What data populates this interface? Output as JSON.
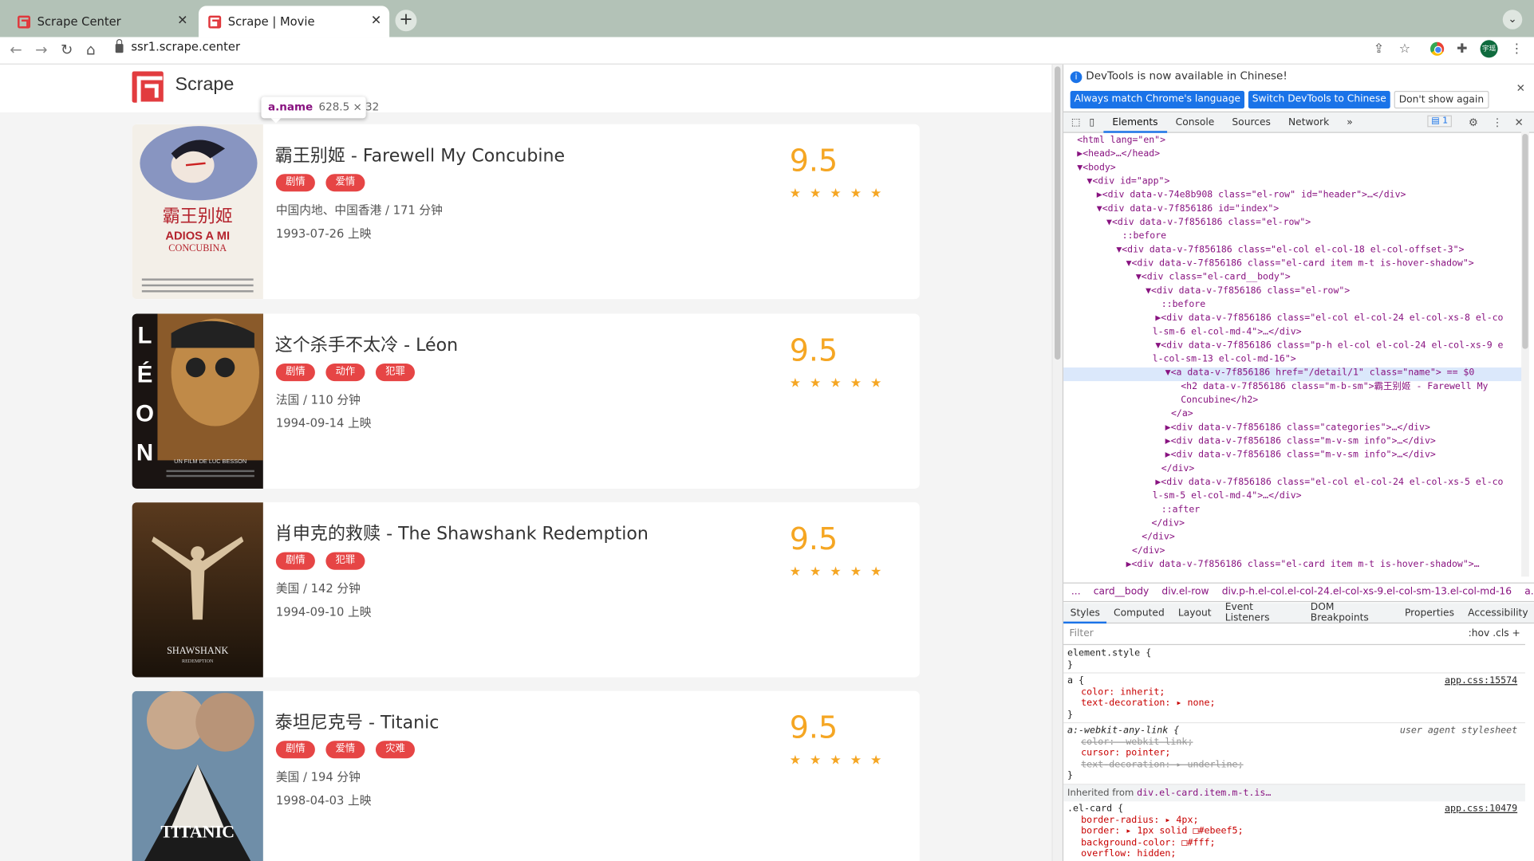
{
  "browser": {
    "tabs": [
      {
        "title": "Scrape Center",
        "active": false
      },
      {
        "title": "Scrape | Movie",
        "active": true
      }
    ],
    "url": "ssr1.scrape.center",
    "profile_initials": "宇瑶"
  },
  "site": {
    "brand": "Scrape",
    "inspect_tooltip": {
      "selector": "a.name",
      "size": "628.5 × 32"
    },
    "movies": [
      {
        "title": "霸王别姬 - Farewell My Concubine",
        "categories": [
          "剧情",
          "爱情"
        ],
        "region_duration": "中国内地、中国香港 / 171 分钟",
        "release": "1993-07-26 上映",
        "score": "9.5",
        "poster": "farewell-my-concubine-poster"
      },
      {
        "title": "这个杀手不太冷 - Léon",
        "categories": [
          "剧情",
          "动作",
          "犯罪"
        ],
        "region_duration": "法国 / 110 分钟",
        "release": "1994-09-14 上映",
        "score": "9.5",
        "poster": "leon-poster"
      },
      {
        "title": "肖申克的救赎 - The Shawshank Redemption",
        "categories": [
          "剧情",
          "犯罪"
        ],
        "region_duration": "美国 / 142 分钟",
        "release": "1994-09-10 上映",
        "score": "9.5",
        "poster": "shawshank-poster"
      },
      {
        "title": "泰坦尼克号 - Titanic",
        "categories": [
          "剧情",
          "爱情",
          "灾难"
        ],
        "region_duration": "美国 / 194 分钟",
        "release": "1998-04-03 上映",
        "score": "9.5",
        "poster": "titanic-poster"
      }
    ],
    "star_rating": {
      "value": 5,
      "max": 5
    }
  },
  "devtools": {
    "notice": "DevTools is now available in Chinese!",
    "notice_buttons": [
      "Always match Chrome's language",
      "Switch DevTools to Chinese",
      "Don't show again"
    ],
    "tabs": [
      "Elements",
      "Console",
      "Sources",
      "Network"
    ],
    "issues_count": "1",
    "breadcrumbs": [
      "...",
      "card__body",
      "div.el-row",
      "div.p-h.el-col.el-col-24.el-col-xs-9.el-col-sm-13.el-col-md-16",
      "a.name"
    ],
    "style_tabs": [
      "Styles",
      "Computed",
      "Layout",
      "Event Listeners",
      "DOM Breakpoints",
      "Properties",
      "Accessibility"
    ],
    "filter_placeholder": "Filter",
    "filter_tools": ":hov  .cls  +",
    "dom_lines": [
      "<html lang=\"en\">",
      "▶<head>…</head>",
      "▼<body>",
      "▼<div id=\"app\">",
      "▶<div data-v-74e8b908 class=\"el-row\" id=\"header\">…</div>",
      "▼<div data-v-7f856186 id=\"index\">",
      "▼<div data-v-7f856186 class=\"el-row\">",
      "::before",
      "▼<div data-v-7f856186 class=\"el-col el-col-18 el-col-offset-3\">",
      "▼<div data-v-7f856186 class=\"el-card item m-t is-hover-shadow\">",
      "▼<div class=\"el-card__body\">",
      "▼<div data-v-7f856186 class=\"el-row\">",
      "::before",
      "▶<div data-v-7f856186 class=\"el-col el-col-24 el-col-xs-8 el-co",
      "l-sm-6 el-col-md-4\">…</div>",
      "▼<div data-v-7f856186 class=\"p-h el-col el-col-24 el-col-xs-9 e",
      "l-col-sm-13 el-col-md-16\">",
      "▼<a data-v-7f856186 href=\"/detail/1\" class=\"name\"> == $0",
      "<h2 data-v-7f856186 class=\"m-b-sm\">霸王别姬 - Farewell My",
      "Concubine</h2>",
      "</a>",
      "▶<div data-v-7f856186 class=\"categories\">…</div>",
      "▶<div data-v-7f856186 class=\"m-v-sm info\">…</div>",
      "▶<div data-v-7f856186 class=\"m-v-sm info\">…</div>",
      "</div>",
      "▶<div data-v-7f856186 class=\"el-col el-col-24 el-col-xs-5 el-co",
      "l-sm-5 el-col-md-4\">…</div>",
      "::after",
      "</div>",
      "</div>",
      "</div>",
      "▶<div data-v-7f856186 class=\"el-card item m-t is-hover-shadow\">…"
    ],
    "styles": {
      "element_style": "element.style {",
      "a_rule": {
        "selector": "a {",
        "source": "app.css:15574",
        "props": [
          "color: inherit;",
          "text-decoration: ▸ none;"
        ]
      },
      "ua_rule": {
        "selector": "a:-webkit-any-link {",
        "source": "user agent stylesheet",
        "props": [
          "color: -webkit-link;",
          "cursor: pointer;",
          "text-decoration: ▸ underline;"
        ]
      },
      "inherited_label": "Inherited from",
      "inherited_from": "div.el-card.item.m-t.is…",
      "card_rule": {
        "selector": ".el-card {",
        "source": "app.css:10479",
        "props": [
          "border-radius: ▸ 4px;",
          "border: ▸ 1px solid □#ebeef5;",
          "background-color: □#fff;",
          "overflow: hidden;"
        ]
      }
    }
  }
}
